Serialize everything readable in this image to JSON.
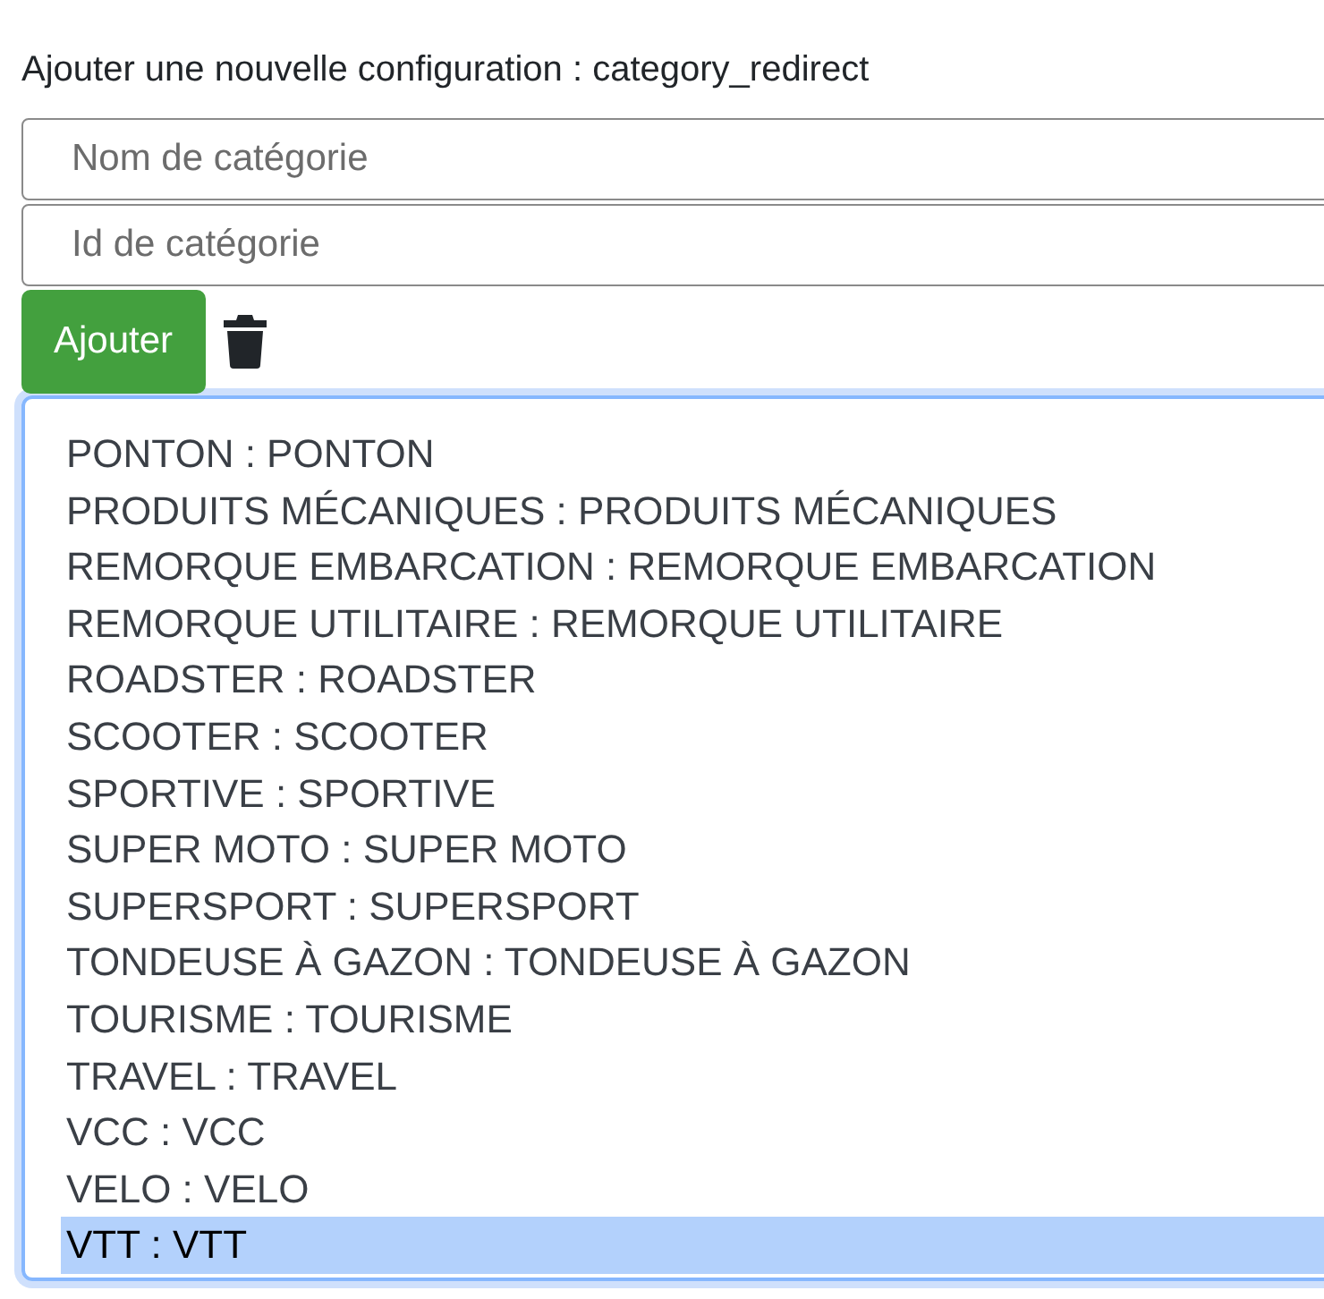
{
  "heading": "Ajouter une nouvelle configuration : category_redirect",
  "fields": [
    {
      "placeholder": "Nom de catégorie"
    },
    {
      "placeholder": "Id de catégorie"
    }
  ],
  "add_button": "Ajouter",
  "options": [
    {
      "label": "PONTON : PONTON",
      "selected": false
    },
    {
      "label": "PRODUITS MÉCANIQUES : PRODUITS MÉCANIQUES",
      "selected": false
    },
    {
      "label": "REMORQUE EMBARCATION : REMORQUE EMBARCATION",
      "selected": false
    },
    {
      "label": "REMORQUE UTILITAIRE : REMORQUE UTILITAIRE",
      "selected": false
    },
    {
      "label": "ROADSTER : ROADSTER",
      "selected": false
    },
    {
      "label": "SCOOTER : SCOOTER",
      "selected": false
    },
    {
      "label": "SPORTIVE : SPORTIVE",
      "selected": false
    },
    {
      "label": "SUPER MOTO : SUPER MOTO",
      "selected": false
    },
    {
      "label": "SUPERSPORT : SUPERSPORT",
      "selected": false
    },
    {
      "label": "TONDEUSE À GAZON : TONDEUSE À GAZON",
      "selected": false
    },
    {
      "label": "TOURISME : TOURISME",
      "selected": false
    },
    {
      "label": "TRAVEL : TRAVEL",
      "selected": false
    },
    {
      "label": "VCC : VCC",
      "selected": false
    },
    {
      "label": "VELO : VELO",
      "selected": false
    },
    {
      "label": "VTT : VTT",
      "selected": true
    }
  ]
}
